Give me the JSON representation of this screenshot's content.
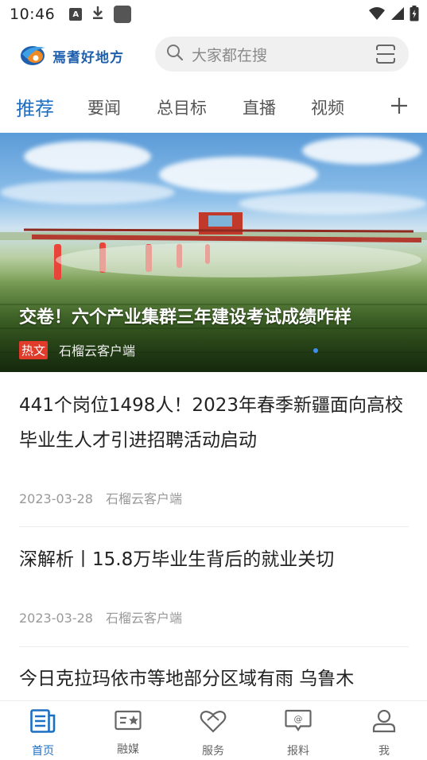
{
  "status_bar": {
    "time": "10:46",
    "notif_a_label": "A"
  },
  "header": {
    "logo_text": "焉耆好地方",
    "search_placeholder": "大家都在搜"
  },
  "tabs": [
    {
      "label": "推荐",
      "active": true
    },
    {
      "label": "要闻",
      "active": false
    },
    {
      "label": "总目标",
      "active": false
    },
    {
      "label": "直播",
      "active": false
    },
    {
      "label": "视频",
      "active": false
    }
  ],
  "banner": {
    "title": "交卷！六个产业集群三年建设考试成绩咋样",
    "badge": "热文",
    "source": "石榴云客户端"
  },
  "news": [
    {
      "title": "441个岗位1498人！2023年春季新疆面向高校毕业生人才引进招聘活动启动",
      "date": "2023-03-28",
      "source": "石榴云客户端"
    },
    {
      "title": "深解析丨15.8万毕业生背后的就业关切",
      "date": "2023-03-28",
      "source": "石榴云客户端"
    },
    {
      "title": "今日克拉玛依市等地部分区域有雨 乌鲁木"
    }
  ],
  "bottom_nav": [
    {
      "label": "首页",
      "icon": "news-icon",
      "active": true
    },
    {
      "label": "融媒",
      "icon": "media-card-icon",
      "active": false
    },
    {
      "label": "服务",
      "icon": "service-heart-icon",
      "active": false
    },
    {
      "label": "报料",
      "icon": "report-chat-icon",
      "active": false
    },
    {
      "label": "我",
      "icon": "profile-icon",
      "active": false
    }
  ],
  "colors": {
    "accent": "#1d6fc4",
    "badge_red": "#e03b2b"
  }
}
